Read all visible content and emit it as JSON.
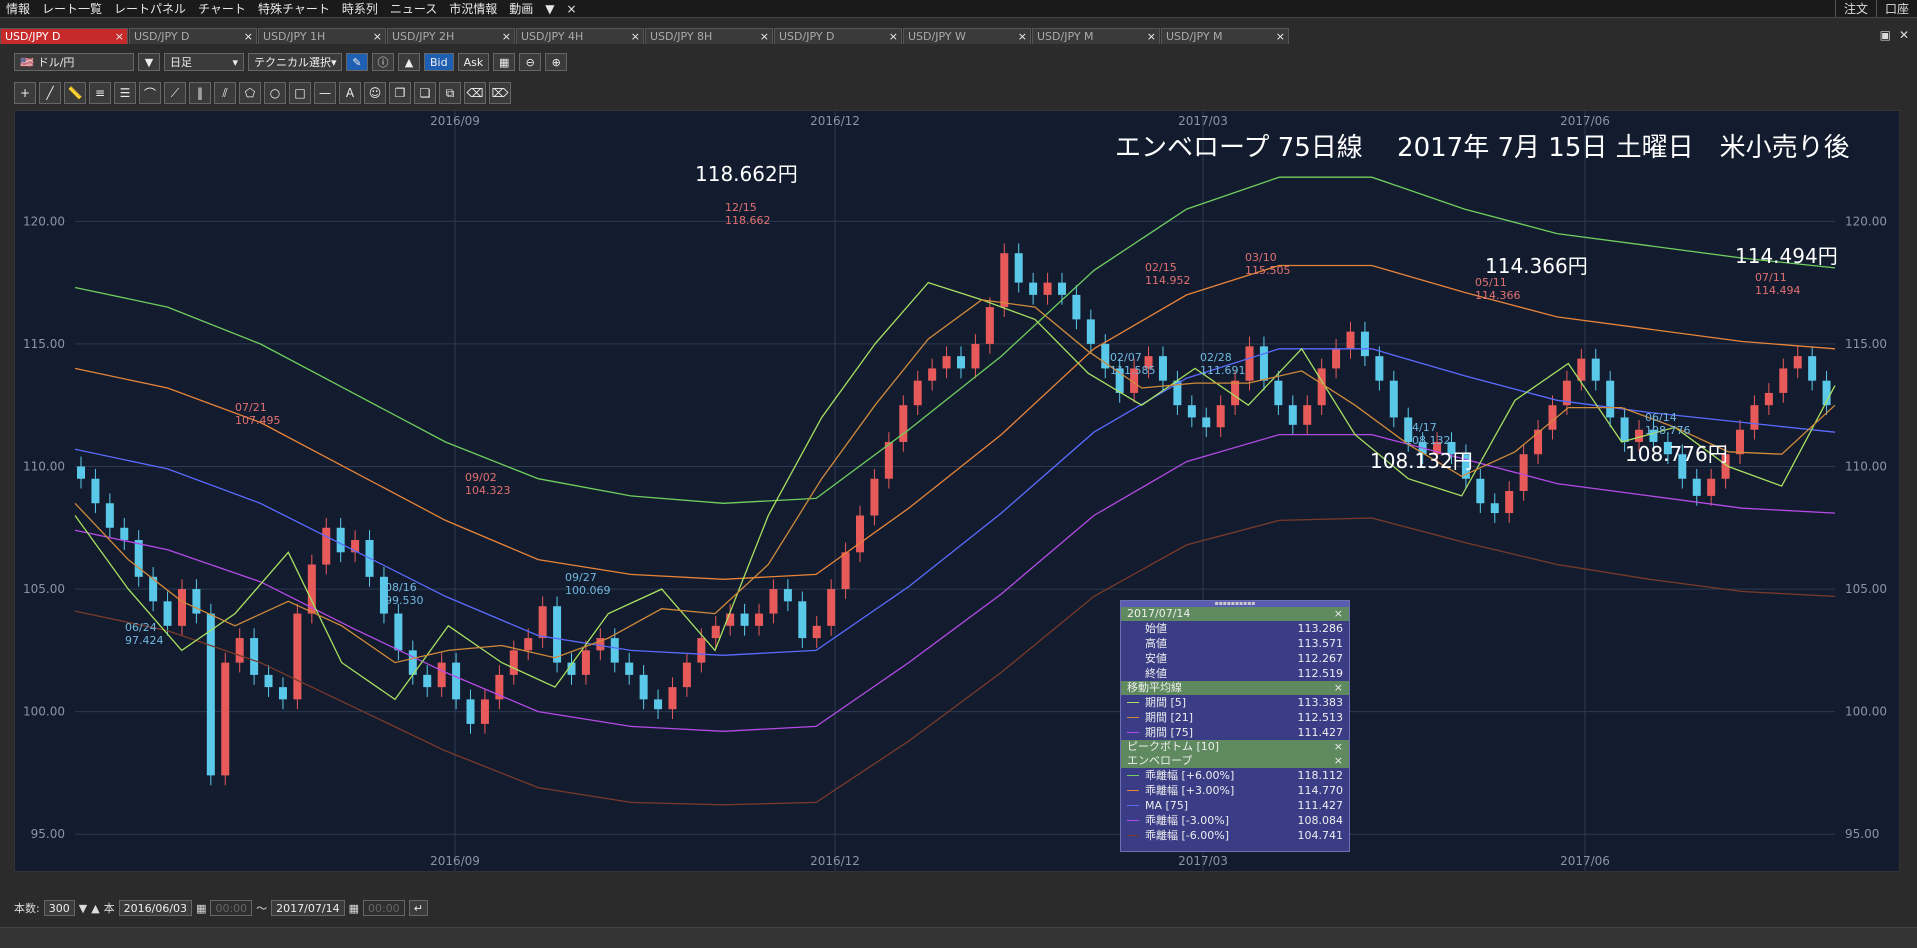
{
  "menu": [
    "情報",
    "レート一覧",
    "レートパネル",
    "チャート",
    "特殊チャート",
    "時系列",
    "ニュース",
    "市況情報",
    "動画",
    "▼",
    "×"
  ],
  "menu_right": [
    "注文",
    "口座"
  ],
  "tabs": [
    "USD/JPY D",
    "USD/JPY D",
    "USD/JPY 1H",
    "USD/JPY 2H",
    "USD/JPY 4H",
    "USD/JPY 8H",
    "USD/JPY D",
    "USD/JPY W",
    "USD/JPY M",
    "USD/JPY M"
  ],
  "toolbar": {
    "currency": "ドル/円",
    "period": "日足",
    "technical": "テクニカル選択",
    "bid": "Bid",
    "ask": "Ask"
  },
  "chart_data": {
    "type": "line",
    "title": "エンベロープ 75日線　 2017年 7月 15日 土曜日　米小売り後",
    "x_ticks": [
      "2016/09",
      "2016/12",
      "2017/03",
      "2017/06"
    ],
    "y_ticks": [
      "95.00",
      "100.00",
      "105.00",
      "110.00",
      "115.00",
      "120.00"
    ],
    "ylim": [
      93.5,
      124.5
    ],
    "grid": true,
    "series": [
      {
        "name": "乖離幅 [+6.00%]",
        "color": "#6fcf5f",
        "values": [
          117.3,
          116.5,
          115.0,
          113.0,
          111.0,
          109.5,
          108.8,
          108.5,
          108.7,
          111.5,
          114.5,
          118.0,
          120.5,
          121.8,
          121.8,
          120.5,
          119.5,
          119.0,
          118.5,
          118.1
        ]
      },
      {
        "name": "乖離幅 [+3.00%]",
        "color": "#e8843a",
        "values": [
          114.0,
          113.2,
          111.8,
          109.8,
          107.8,
          106.2,
          105.6,
          105.4,
          105.6,
          108.3,
          111.3,
          114.8,
          117.0,
          118.2,
          118.2,
          117.1,
          116.1,
          115.6,
          115.1,
          114.8
        ]
      },
      {
        "name": "MA [75]",
        "color": "#5a6bff",
        "values": [
          110.7,
          109.9,
          108.5,
          106.6,
          104.7,
          103.1,
          102.5,
          102.3,
          102.5,
          105.1,
          108.1,
          111.4,
          113.6,
          114.8,
          114.8,
          113.7,
          112.7,
          112.2,
          111.8,
          111.4
        ]
      },
      {
        "name": "乖離幅 [-3.00%]",
        "color": "#b44ae6",
        "values": [
          107.4,
          106.6,
          105.3,
          103.4,
          101.6,
          100.0,
          99.4,
          99.2,
          99.4,
          102.0,
          104.8,
          108.0,
          110.2,
          111.3,
          111.3,
          110.3,
          109.3,
          108.8,
          108.3,
          108.1
        ]
      },
      {
        "name": "乖離幅 [-6.00%]",
        "color": "#7a3a2a",
        "values": [
          104.1,
          103.3,
          102.0,
          100.2,
          98.4,
          96.9,
          96.3,
          96.2,
          96.3,
          98.8,
          101.6,
          104.7,
          106.8,
          107.8,
          107.9,
          106.9,
          106.0,
          105.4,
          104.9,
          104.7
        ]
      },
      {
        "name": "期間 [5]",
        "color": "#a8e060",
        "values": [
          108,
          105,
          102.5,
          104,
          106.5,
          102,
          100.5,
          103.5,
          102,
          101,
          104,
          105,
          102.5,
          108,
          112,
          115,
          117.5,
          116.8,
          116,
          113.8,
          112.5,
          114,
          112.5,
          114.8,
          111.3,
          109.5,
          108.8,
          112.7,
          114.2,
          111,
          111.6,
          110,
          109.2,
          113.3
        ]
      },
      {
        "name": "期間 [21]",
        "color": "#d08a3a",
        "values": [
          108.5,
          106.2,
          104.5,
          103.5,
          104.5,
          103.5,
          102,
          102.5,
          102.7,
          102.2,
          103,
          104.2,
          104,
          106,
          109.5,
          112.5,
          115.2,
          116.8,
          116.5,
          114.7,
          113.2,
          113.4,
          113.4,
          113.9,
          112.5,
          110.9,
          109.6,
          110.6,
          112.4,
          112.4,
          111.6,
          110.6,
          110.5,
          112.5
        ]
      }
    ],
    "price_labels": [
      {
        "date": "12/15",
        "value": "118.662",
        "big": "118.662円"
      },
      {
        "date": "05/11",
        "value": "114.366",
        "big": "114.366円"
      },
      {
        "date": "07/11",
        "value": "114.494",
        "big": "114.494円"
      },
      {
        "date": "04/17",
        "value": "108.132",
        "big": "108.132円"
      },
      {
        "date": "06/14",
        "value": "108.776",
        "big": "108.776円"
      },
      {
        "date": "07/21",
        "value": "107.495"
      },
      {
        "date": "09/02",
        "value": "104.323"
      },
      {
        "date": "02/15",
        "value": "114.952"
      },
      {
        "date": "03/10",
        "value": "115.505"
      },
      {
        "date": "06/24",
        "value": "97.424"
      },
      {
        "date": "08/16",
        "value": "99.530"
      },
      {
        "date": "09/27",
        "value": "100.069"
      },
      {
        "date": "02/07",
        "value": "111.585"
      },
      {
        "date": "02/28",
        "value": "111.691"
      }
    ],
    "closes": [
      109.5,
      108.5,
      107.5,
      107.0,
      105.5,
      104.5,
      103.5,
      105.0,
      104.0,
      97.4,
      102.0,
      103.0,
      101.5,
      101.0,
      100.5,
      104.0,
      106.0,
      107.5,
      106.5,
      107.0,
      105.5,
      104.0,
      102.5,
      101.5,
      101.0,
      102.0,
      100.5,
      99.5,
      100.5,
      101.5,
      102.5,
      103.0,
      104.3,
      102.0,
      101.5,
      102.5,
      103.0,
      102.0,
      101.5,
      100.5,
      100.1,
      101.0,
      102.0,
      103.0,
      103.5,
      104.0,
      103.5,
      104.0,
      105.0,
      104.5,
      103.0,
      103.5,
      105.0,
      106.5,
      108.0,
      109.5,
      111.0,
      112.5,
      113.5,
      114.0,
      114.5,
      114.0,
      115.0,
      116.5,
      118.7,
      117.5,
      117.0,
      117.5,
      117.0,
      116.0,
      115.0,
      114.0,
      113.0,
      114.0,
      114.5,
      113.5,
      112.5,
      112.0,
      111.6,
      112.5,
      113.5,
      114.9,
      113.5,
      112.5,
      111.7,
      112.5,
      114.0,
      114.8,
      115.5,
      114.5,
      113.5,
      112.0,
      111.0,
      110.5,
      111.0,
      110.5,
      109.5,
      108.5,
      108.1,
      109.0,
      110.5,
      111.5,
      112.5,
      113.5,
      114.4,
      113.5,
      112.0,
      111.0,
      111.5,
      111.0,
      110.5,
      109.5,
      108.8,
      109.5,
      110.5,
      111.5,
      112.5,
      113.0,
      114.0,
      114.5,
      113.5,
      112.5
    ]
  },
  "databox": {
    "date": "2017/07/14",
    "ohlc": [
      {
        "label": "始値",
        "value": "113.286"
      },
      {
        "label": "高値",
        "value": "113.571"
      },
      {
        "label": "安値",
        "value": "112.267"
      },
      {
        "label": "終値",
        "value": "112.519"
      }
    ],
    "ma_title": "移動平均線",
    "ma": [
      {
        "label": "期間 [5]",
        "value": "113.383",
        "color": "#a8e060"
      },
      {
        "label": "期間 [21]",
        "value": "112.513",
        "color": "#d08a3a"
      },
      {
        "label": "期間 [75]",
        "value": "111.427",
        "color": "#b44ae6"
      }
    ],
    "peak_title": "ピークボトム [10]",
    "env_title": "エンベロープ",
    "env": [
      {
        "label": "乖離幅 [+6.00%]",
        "value": "118.112",
        "color": "#6fcf5f"
      },
      {
        "label": "乖離幅 [+3.00%]",
        "value": "114.770",
        "color": "#e8843a"
      },
      {
        "label": "MA [75]",
        "value": "111.427",
        "color": "#5a6bff"
      },
      {
        "label": "乖離幅 [-3.00%]",
        "value": "108.084",
        "color": "#b44ae6"
      },
      {
        "label": "乖離幅 [-6.00%]",
        "value": "104.741",
        "color": "#7a3a2a"
      }
    ]
  },
  "bottom": {
    "count_label": "本数:",
    "count": "300",
    "unit": "本",
    "from": "2016/06/03",
    "to": "2017/07/14",
    "tilde": "〜",
    "time_placeholder": "00:00"
  }
}
